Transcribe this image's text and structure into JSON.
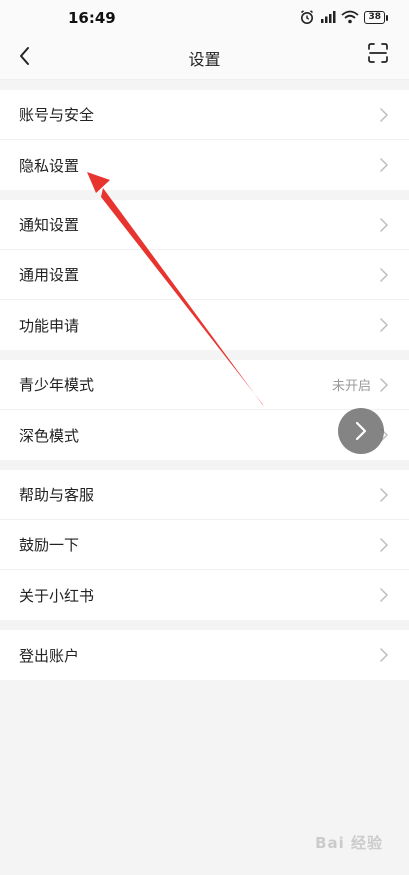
{
  "status": {
    "time": "16:49",
    "battery": "38"
  },
  "nav": {
    "title": "设置"
  },
  "groups": [
    [
      {
        "label": "账号与安全"
      },
      {
        "label": "隐私设置"
      }
    ],
    [
      {
        "label": "通知设置"
      },
      {
        "label": "通用设置"
      },
      {
        "label": "功能申请"
      }
    ],
    [
      {
        "label": "青少年模式",
        "value": "未开启"
      },
      {
        "label": "深色模式"
      }
    ],
    [
      {
        "label": "帮助与客服"
      },
      {
        "label": "鼓励一下"
      },
      {
        "label": "关于小红书"
      }
    ],
    [
      {
        "label": "登出账户"
      }
    ]
  ],
  "watermark": "Bai 经验",
  "colors": {
    "annotation_arrow": "#e8342f",
    "chevron": "#bdbdbd"
  }
}
